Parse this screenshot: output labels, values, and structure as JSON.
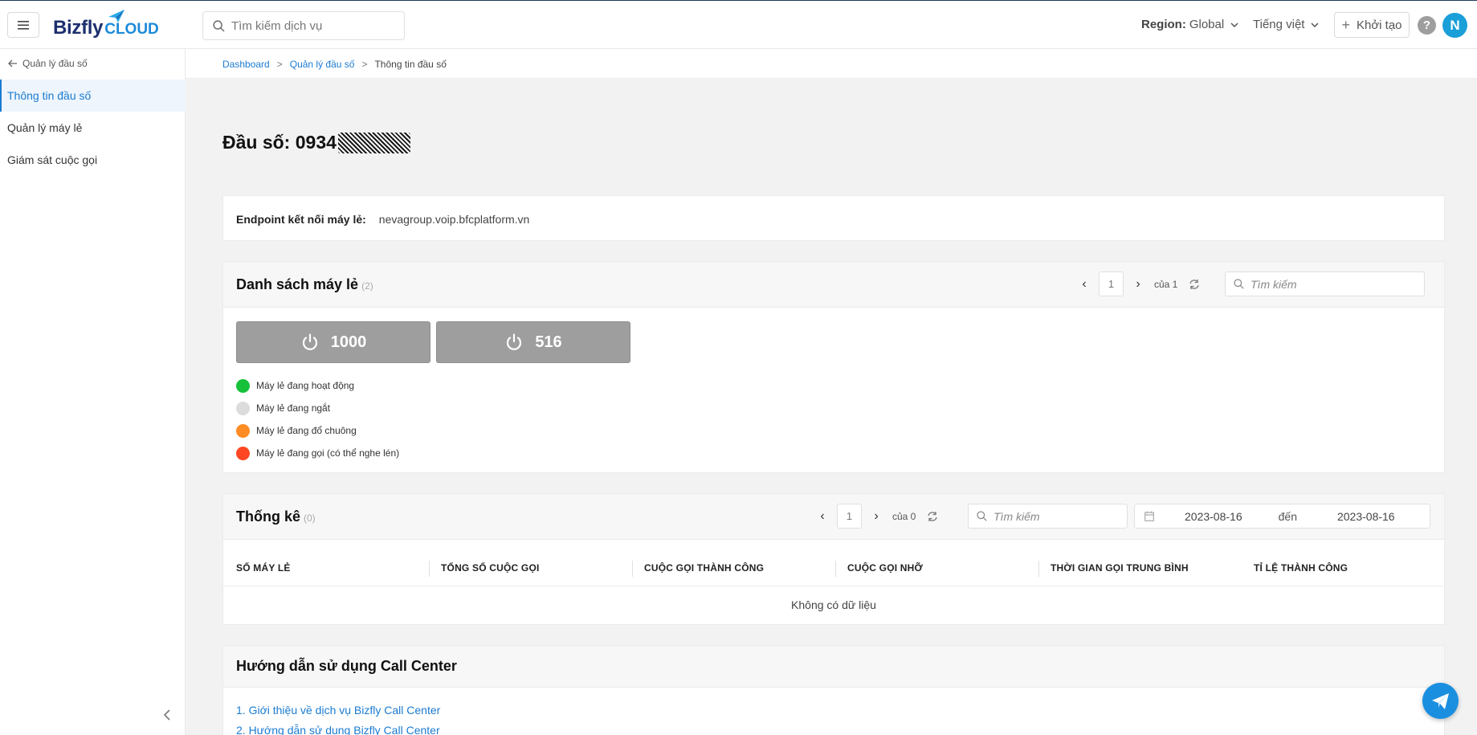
{
  "header": {
    "logo_text": "Bizfly",
    "logo_suffix": "CLOUD",
    "search_placeholder": "Tìm kiếm dịch vụ",
    "region_label": "Region:",
    "region_value": "Global",
    "language": "Tiếng việt",
    "create_label": "Khởi tạo",
    "help_label": "?",
    "avatar_initial": "N"
  },
  "sidebar": {
    "back_label": "Quản lý đầu số",
    "items": [
      {
        "label": "Thông tin đầu số",
        "active": true
      },
      {
        "label": "Quản lý máy lẻ",
        "active": false
      },
      {
        "label": "Giám sát cuộc gọi",
        "active": false
      }
    ],
    "collapse_icon": "chevron-left-icon"
  },
  "breadcrumb": {
    "items": [
      "Dashboard",
      "Quản lý đầu số",
      "Thông tin đầu số"
    ],
    "separator": ">"
  },
  "page": {
    "title_prefix": "Đầu số: 0934"
  },
  "endpoint": {
    "label": "Endpoint kết nối máy lẻ:",
    "value": "nevagroup.voip.bfcplatform.vn"
  },
  "extensions": {
    "title": "Danh sách máy lẻ",
    "count": "(2)",
    "page": "1",
    "of_label": "của 1",
    "search_placeholder": "Tìm kiếm",
    "items": [
      "1000",
      "516"
    ],
    "legend": [
      {
        "label": "Máy lẻ đang hoạt động",
        "color": "#17c13a"
      },
      {
        "label": "Máy lẻ đang ngắt",
        "color": "#dcdcdc"
      },
      {
        "label": "Máy lẻ đang đổ chuông",
        "color": "#ff8c24"
      },
      {
        "label": "Máy lẻ đang gọi (có thể nghe lén)",
        "color": "#ff4622"
      }
    ]
  },
  "stats": {
    "title": "Thống kê",
    "count": "(0)",
    "page": "1",
    "of_label": "của 0",
    "search_placeholder": "Tìm kiếm",
    "date_from": "2023-08-16",
    "date_to_label": "đến",
    "date_to": "2023-08-16",
    "columns": [
      "SỐ MÁY LẺ",
      "TỔNG SỐ CUỘC GỌI",
      "CUỘC GỌI THÀNH CÔNG",
      "CUỘC GỌI NHỠ",
      "THỜI GIAN GỌI TRUNG BÌNH",
      "TỈ LỆ THÀNH CÔNG"
    ],
    "empty_text": "Không có dữ liệu"
  },
  "guide": {
    "title": "Hướng dẫn sử dụng Call Center",
    "links": [
      "1. Giới thiệu về dịch vụ Bizfly Call Center",
      "2. Hướng dẫn sử dụng Bizfly Call Center"
    ]
  },
  "colors": {
    "accent": "#1b7bd1",
    "brand_dark": "#1d2f6f",
    "avatar": "#1a9fd8",
    "ext_button": "#9e9e9e"
  }
}
